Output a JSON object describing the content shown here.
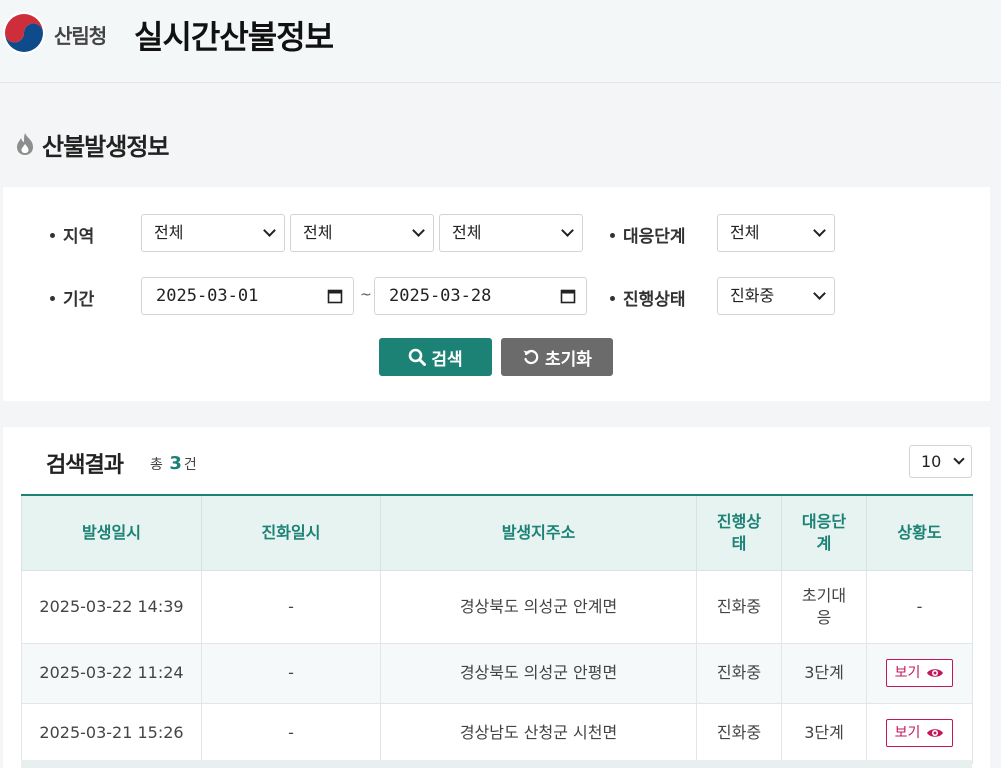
{
  "header": {
    "agency": "산림청",
    "title": "실시간산불정보"
  },
  "section": {
    "title": "산불발생정보"
  },
  "filters": {
    "region_label": "지역",
    "region_selects": [
      "전체",
      "전체",
      "전체"
    ],
    "response_label": "대응단계",
    "response_value": "전체",
    "period_label": "기간",
    "start_date": "2025-03-01",
    "end_date": "2025-03-28",
    "tilde": "~",
    "status_label": "진행상태",
    "status_value": "진화중",
    "search_button": "검색",
    "reset_button": "초기화"
  },
  "results": {
    "title": "검색결과",
    "total_prefix": "총",
    "total_count": "3",
    "total_suffix": "건",
    "page_size": "10",
    "columns": [
      "발생일시",
      "진화일시",
      "발생지주소",
      "진행상\n태",
      "대응단\n계",
      "상황도"
    ],
    "rows": [
      {
        "occurred": "2025-03-22 14:39",
        "extinguished": "-",
        "address": "경상북도 의성군 안계면",
        "status": "진화중",
        "stage": "초기대\n응",
        "map": "-"
      },
      {
        "occurred": "2025-03-22 11:24",
        "extinguished": "-",
        "address": "경상북도 의성군 안평면",
        "status": "진화중",
        "stage": "3단계",
        "map": "보기"
      },
      {
        "occurred": "2025-03-21 15:26",
        "extinguished": "-",
        "address": "경상남도 산청군 시천면",
        "status": "진화중",
        "stage": "3단계",
        "map": "보기"
      }
    ]
  },
  "colors": {
    "accent": "#1d8276",
    "view": "#c2185b",
    "reset": "#6b6b6b"
  }
}
